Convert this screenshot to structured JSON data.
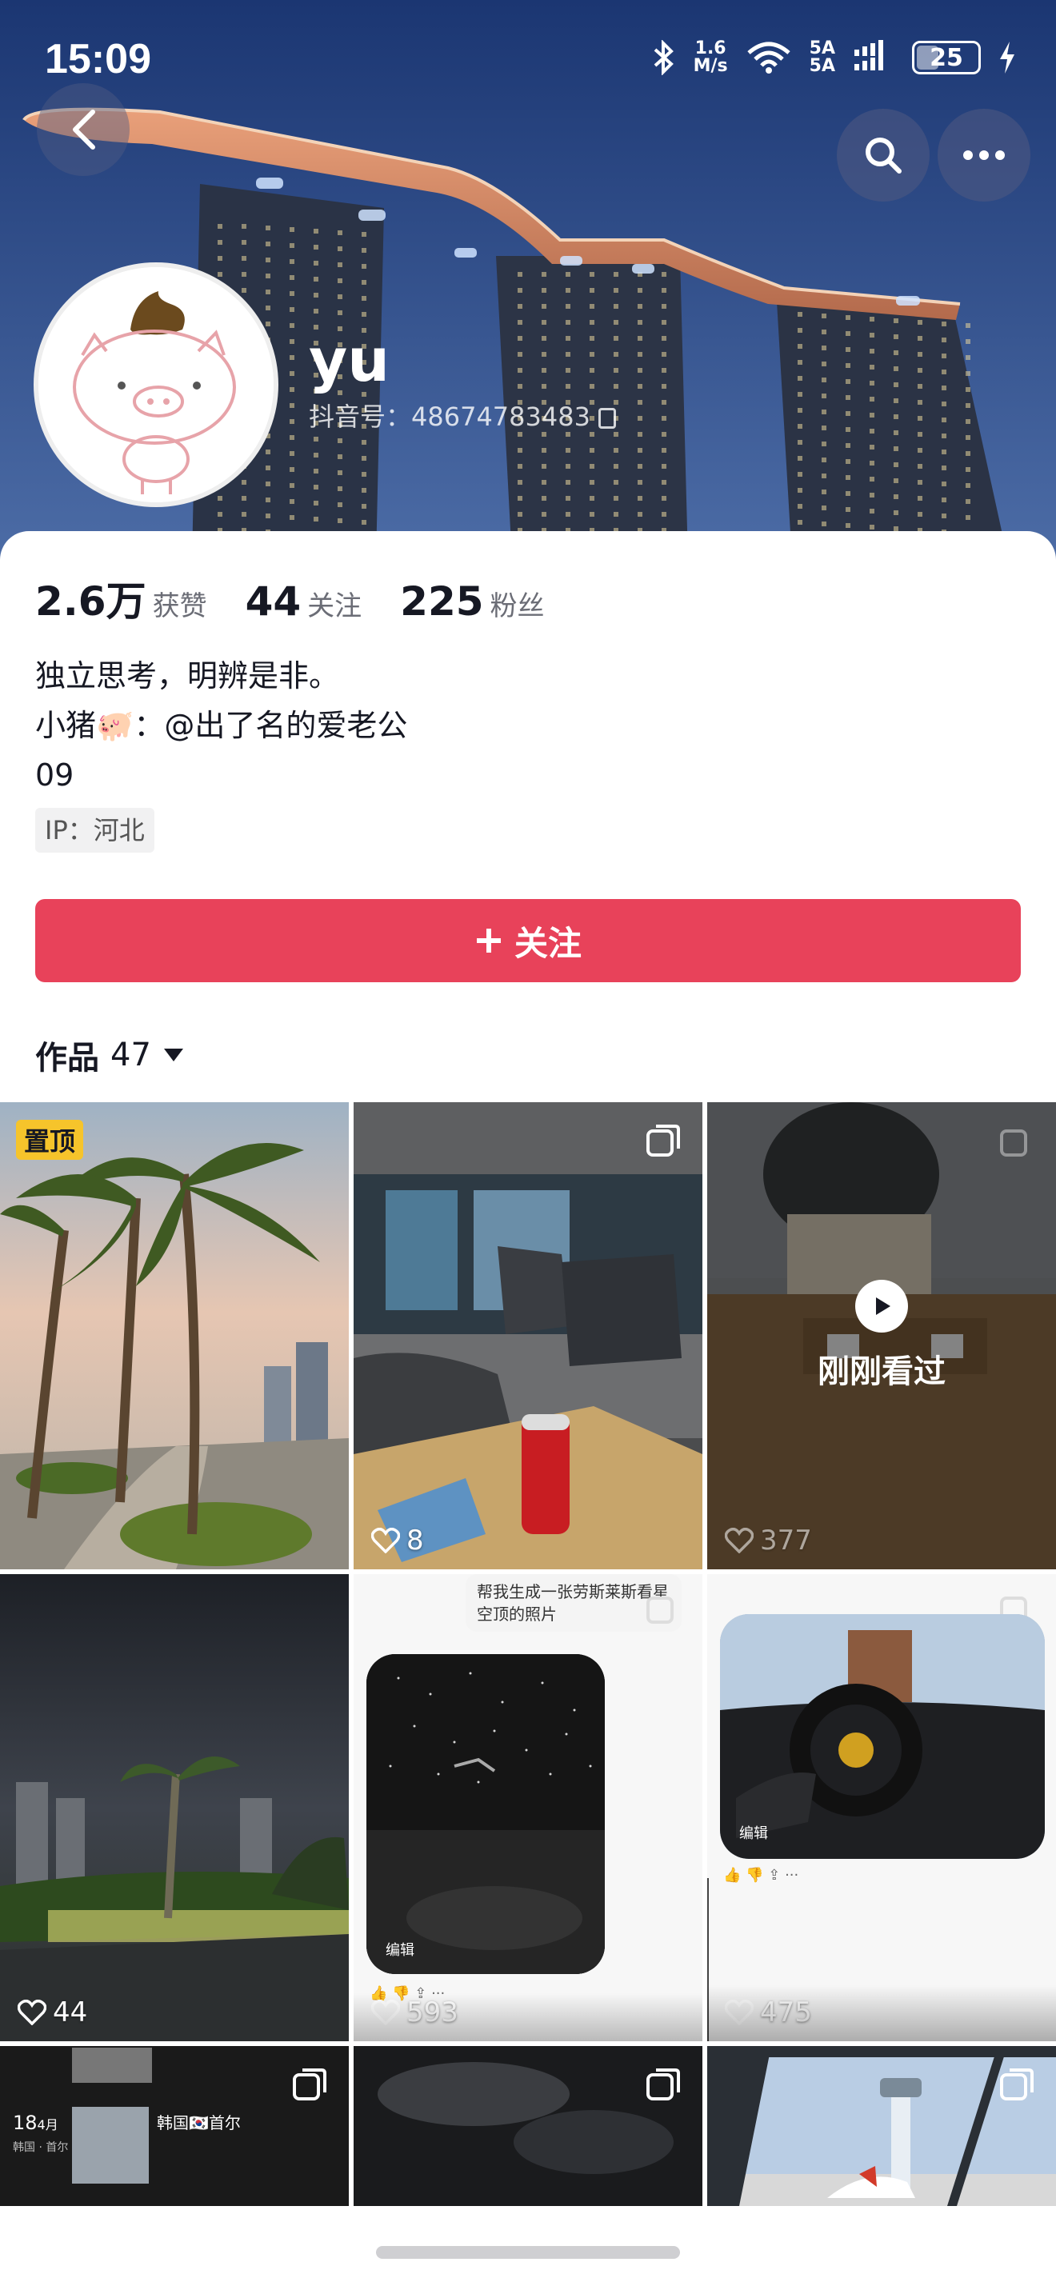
{
  "status_bar": {
    "time": "15:09",
    "net_speed_top": "1.6",
    "net_speed_bottom": "M/s",
    "sim1": "5A",
    "sim2": "5A",
    "battery": "25"
  },
  "profile": {
    "username": "yu",
    "douyin_id": "抖音号：48674783483",
    "stats": [
      {
        "value": "2.6万",
        "label": "获赞"
      },
      {
        "value": "44",
        "label": "关注"
      },
      {
        "value": "225",
        "label": "粉丝"
      }
    ],
    "bio": [
      "独立思考，明辨是非。",
      "小猪🐖：@出了名的爱老公",
      "09"
    ],
    "ip": "IP：河北",
    "follow_label": "关注"
  },
  "works": {
    "label": "作品",
    "count": "47"
  },
  "grid": [
    {
      "pinned": "置顶",
      "likes": ""
    },
    {
      "likes": "8"
    },
    {
      "just_watched": "刚刚看过",
      "likes": "377"
    },
    {
      "likes": "44"
    },
    {
      "caption": "帮我生成一张劳斯莱斯看星空顶的照片",
      "edit": "编辑",
      "likes": "593"
    },
    {
      "edit": "编辑",
      "likes": "475"
    },
    {
      "date_day": "18",
      "date_month": "4月",
      "loc_small": "韩国 · 首尔",
      "title": "韩国🇰🇷首尔"
    },
    {},
    {}
  ],
  "colors": {
    "accent": "#e8425a",
    "pin": "#f6c42b"
  }
}
